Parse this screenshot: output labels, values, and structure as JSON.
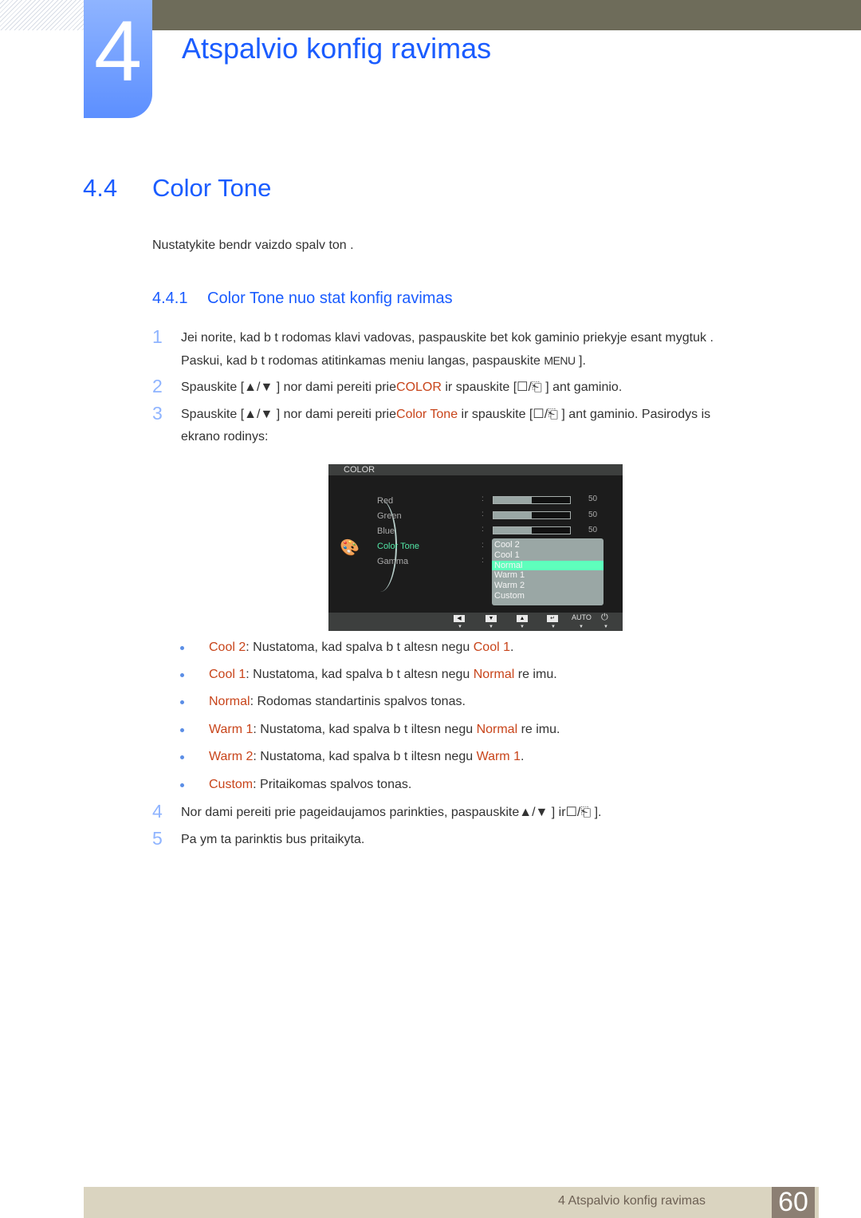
{
  "chapter": {
    "number": "4",
    "title": "Atspalvio konfig ravimas"
  },
  "section": {
    "number": "4.4",
    "title": "Color Tone",
    "intro": "Nustatykite bendr  vaizdo spalv  ton ."
  },
  "subsection": {
    "number": "4.4.1",
    "title": "Color Tone nuo stat  konfig ravimas"
  },
  "steps": [
    {
      "n": "1",
      "line1": "Jei norite, kad b t  rodomas klavi   vadovas, paspauskite bet kok  gaminio priekyje esant  mygtuk .",
      "line2_pre": "Paskui, kad b t  rodomas atitinkamas meniu langas, paspauskite ",
      "line2_key": "MENU",
      "line2_post": " ]."
    },
    {
      "n": "2",
      "pre": "Spauskite [▲/▼ ] nor dami pereiti prie",
      "hl": "COLOR",
      "post": " ir spauskite [☐/⎗ ] ant gaminio."
    },
    {
      "n": "3",
      "pre": "Spauskite [▲/▼ ] nor dami pereiti prie",
      "hl": "Color Tone",
      "post": " ir spauskite [☐/⎗ ] ant gaminio. Pasirodys  is",
      "line2": "ekrano rodinys:"
    },
    {
      "n": "4",
      "text": "Nor dami pereiti prie pageidaujamos parinkties, paspauskite▲/▼  ] ir☐/⎗   ]."
    },
    {
      "n": "5",
      "text": "Pa ym ta parinktis bus pritaikyta."
    }
  ],
  "osd": {
    "header": "COLOR",
    "icon": "palette-icon",
    "items": [
      {
        "label": "Red",
        "value": "50",
        "level": 0.5
      },
      {
        "label": "Green",
        "value": "50",
        "level": 0.5
      },
      {
        "label": "Blue",
        "value": "50",
        "level": 0.5
      },
      {
        "label": "Color Tone",
        "active": true
      },
      {
        "label": "Gamma"
      }
    ],
    "colon": ":",
    "dropdown_options": [
      "Cool 2",
      "Cool 1",
      "Normal",
      "Warm 1",
      "Warm 2",
      "Custom"
    ],
    "dropdown_selected": "Normal",
    "footer_buttons": [
      "left-arrow",
      "down-arrow",
      "up-arrow",
      "enter",
      "AUTO",
      "power"
    ],
    "auto_label": "AUTO",
    "colors": {
      "active": "#52e6a6",
      "selected": "#5effbc"
    }
  },
  "options": [
    {
      "name": "Cool 2",
      "desc": ": Nustatoma, kad spalva b t   altesn  negu ",
      "ref": "Cool 1",
      "tail": "."
    },
    {
      "name": "Cool 1",
      "desc": ": Nustatoma, kad spalva b t   altesn  negu ",
      "ref": "Normal",
      "tail": " re imu."
    },
    {
      "name": "Normal",
      "desc": ": Rodomas standartinis spalvos tonas.",
      "ref": "",
      "tail": ""
    },
    {
      "name": "Warm 1",
      "desc": ": Nustatoma, kad spalva b t   iltesn  negu ",
      "ref": "Normal",
      "tail": " re imu."
    },
    {
      "name": "Warm 2",
      "desc": ": Nustatoma, kad spalva b t   iltesn  negu ",
      "ref": "Warm 1",
      "tail": "."
    },
    {
      "name": "Custom",
      "desc": ": Pritaikomas spalvos tonas.",
      "ref": "",
      "tail": ""
    }
  ],
  "footer": {
    "text": "4 Atspalvio konfig ravimas",
    "page": "60"
  },
  "colors": {
    "heading": "#1a5cff",
    "highlight": "#c8441a",
    "topbar": "#6e6c5a",
    "footer": "#dad4c0",
    "page_box": "#8c7f73"
  }
}
